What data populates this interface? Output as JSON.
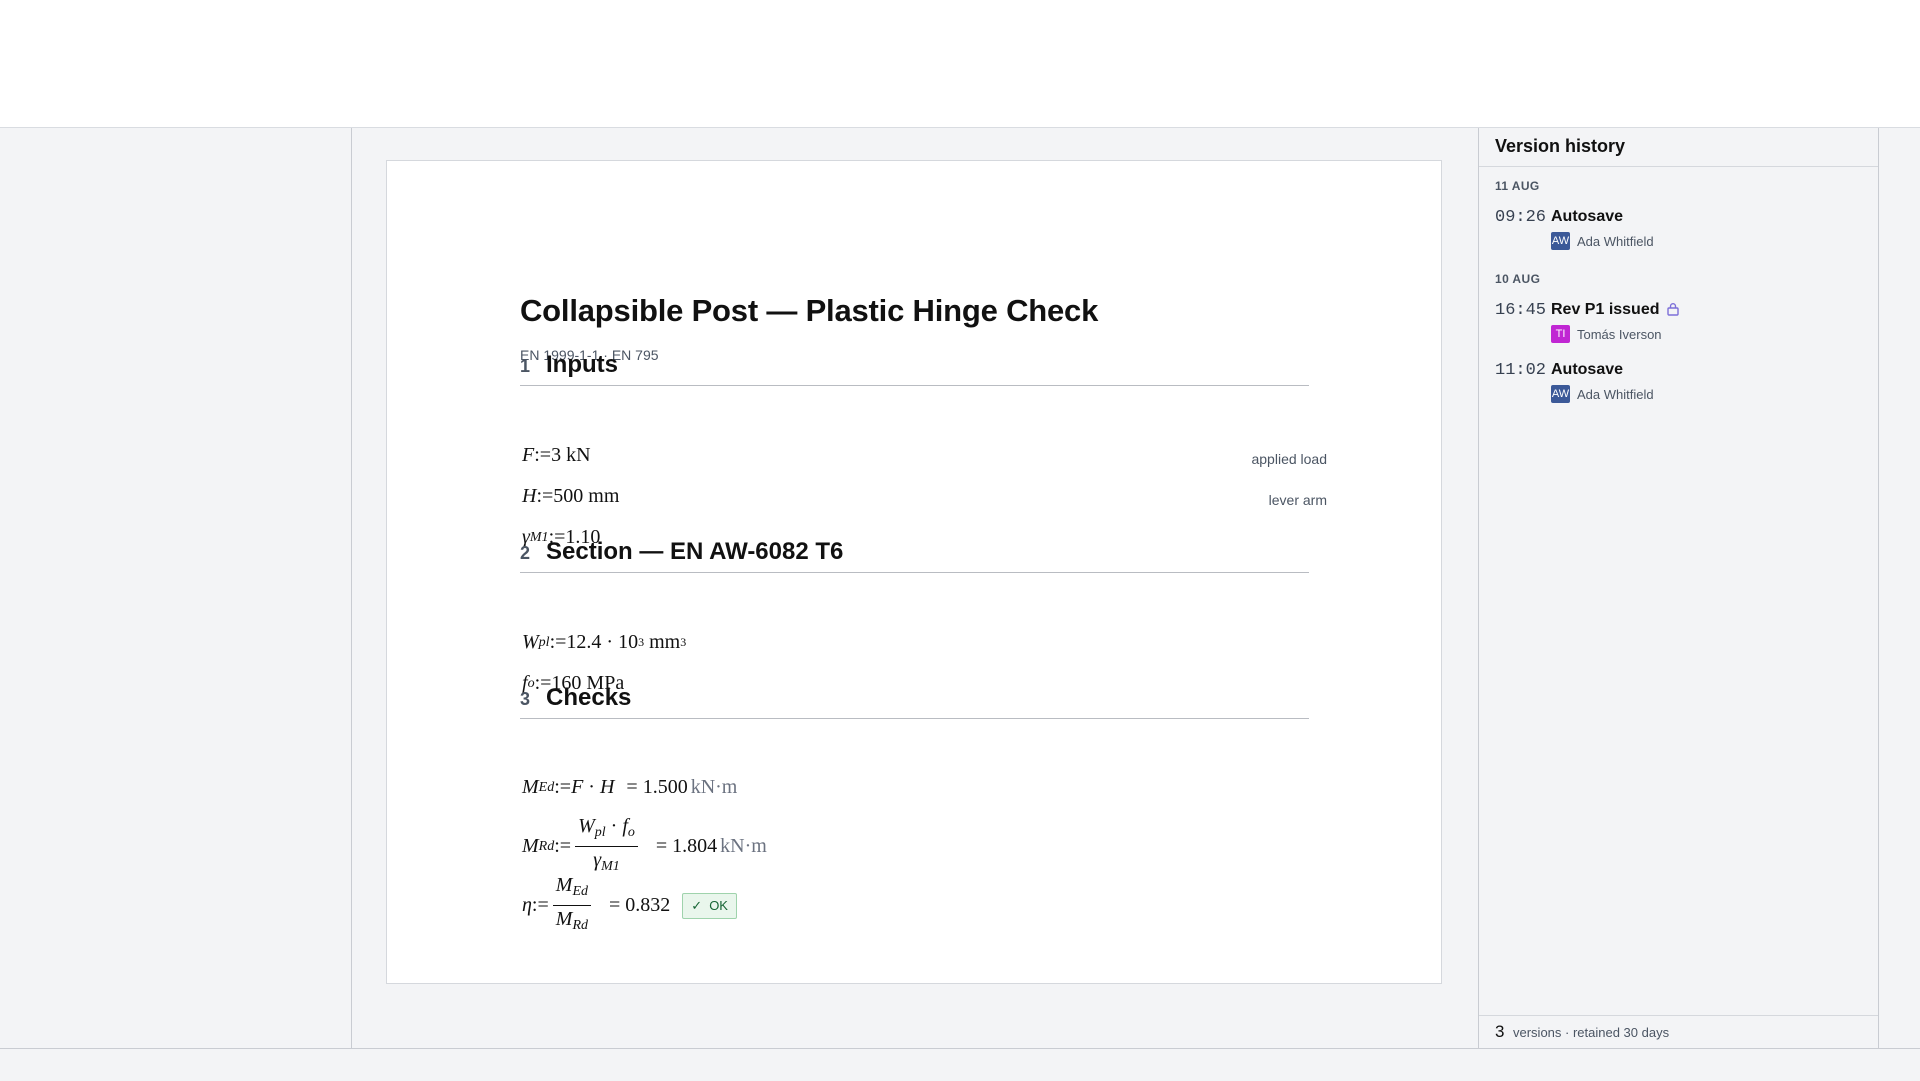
{
  "document": {
    "title": "Collapsible Post — Plastic Hinge Check",
    "subtitle": "EN 1999-1-1 · EN 795",
    "sections": [
      {
        "num": "1",
        "title": "Inputs"
      },
      {
        "num": "2",
        "title": "Section — EN AW-6082 T6"
      },
      {
        "num": "3",
        "title": "Checks"
      }
    ],
    "inputs": {
      "F": {
        "sym": "F",
        "def": ":=",
        "value": "3 kN",
        "note": "applied load"
      },
      "H": {
        "sym": "H",
        "def": ":=",
        "value": "500 mm",
        "note": "lever arm"
      },
      "gamma": {
        "sym": "γ",
        "sub": "M1",
        "def": ":=",
        "value": "1.10"
      }
    },
    "section": {
      "Wpl": {
        "sym": "W",
        "sub": "pl",
        "def": ":=",
        "value": "12.4 · 10",
        "exp": "3",
        "unit": " mm",
        "unit_exp": "3"
      },
      "fo": {
        "sym": "f",
        "sub": "o",
        "def": ":=",
        "value": "160 MPa"
      }
    },
    "checks": {
      "MEd": {
        "sym": "M",
        "sub": "Ed",
        "def": ":=",
        "expr_a": "F",
        "dot": " · ",
        "expr_b": "H",
        "result": "= 1.500",
        "unit": "kN·m"
      },
      "MRd": {
        "sym": "M",
        "sub": "Rd",
        "def": ":=",
        "num_a": "W",
        "num_a_sub": "pl",
        "num_dot": " · ",
        "num_b": "f",
        "num_b_sub": "o",
        "den": "γ",
        "den_sub": "M1",
        "result": "= 1.804",
        "unit": "kN·m"
      },
      "eta": {
        "sym": "η",
        "def": ":=",
        "num": "M",
        "num_sub": "Ed",
        "den": "M",
        "den_sub": "Rd",
        "result": "= 0.832",
        "badge": "OK"
      }
    }
  },
  "version_history": {
    "title": "Version history",
    "groups": [
      {
        "date": "11 AUG",
        "entries": [
          {
            "time": "09:26",
            "label": "Autosave",
            "initials": "AW",
            "author": "Ada Whitfield"
          }
        ]
      },
      {
        "date": "10 AUG",
        "entries": [
          {
            "time": "16:45",
            "label": "Rev P1 issued",
            "initials": "TI",
            "author": "Tomás Iverson",
            "locked": true
          },
          {
            "time": "11:02",
            "label": "Autosave",
            "initials": "AW",
            "author": "Ada Whitfield"
          }
        ]
      }
    ],
    "footer": {
      "count": "3",
      "text": "versions · retained 30 days"
    }
  },
  "colors": {
    "accent_avatar_aw": "#3b5998",
    "accent_avatar_ti": "#c026d3",
    "ok_green": "#166534",
    "lock_icon": "#7c6fd8"
  }
}
